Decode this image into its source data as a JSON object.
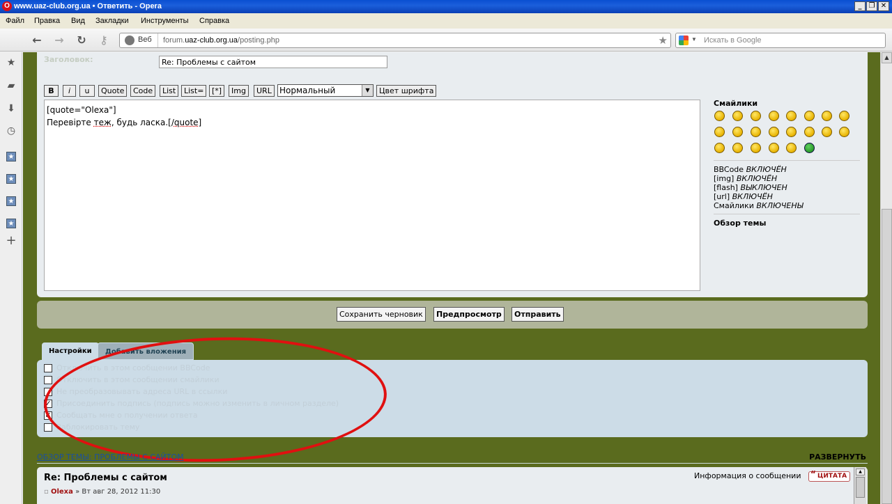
{
  "window": {
    "title": "www.uaz-club.org.ua • Ответить - Opera",
    "minimize": "_",
    "restore": "❐",
    "close": "✕"
  },
  "menu": [
    "Файл",
    "Правка",
    "Вид",
    "Закладки",
    "Инструменты",
    "Справка"
  ],
  "nav": {
    "veb_label": "Веб",
    "url_prefix": "forum.",
    "url_host": "uaz-club.org.ua",
    "url_path": "/posting.php",
    "search_placeholder": "Искать в Google"
  },
  "form": {
    "subject_label": "Заголовок:",
    "subject_value": "Re: Проблемы с сайтом",
    "bbcode_buttons": [
      "B",
      "i",
      "u",
      "Quote",
      "Code",
      "List",
      "List=",
      "[*]",
      "Img",
      "URL"
    ],
    "font_size_value": "Нормальный",
    "font_color_button": "Цвет шрифта",
    "text_line1": "[quote=\"Olexa\"]",
    "text_line2_a": "Перевірте ",
    "text_line2_b": "теж",
    "text_line2_c": ", будь ласка.[/",
    "text_line2_d": "quote",
    "text_line2_e": "]"
  },
  "sidebar": {
    "smileys_title": "Смайлики",
    "options": [
      {
        "name": "BBCode",
        "state": "ВКЛЮЧЁН"
      },
      {
        "name": "[img]",
        "state": "ВКЛЮЧЁН"
      },
      {
        "name": "[flash]",
        "state": "ВЫКЛЮЧЕН"
      },
      {
        "name": "[url]",
        "state": "ВКЛЮЧЁН"
      },
      {
        "name": "Смайлики",
        "state": "ВКЛЮЧЕНЫ"
      }
    ],
    "topic_review": "Обзор темы"
  },
  "submit": {
    "save_draft": "Сохранить черновик",
    "preview": "Предпросмотр",
    "send": "Отправить"
  },
  "tabs": {
    "settings": "Настройки",
    "attachments": "Добавить вложения"
  },
  "checkboxes": [
    {
      "checked": false,
      "label": "Отключить в этом сообщении BBCode"
    },
    {
      "checked": false,
      "label": "Отключить в этом сообщении смайлики"
    },
    {
      "checked": false,
      "label": "Не преобразовывать адреса URL в ссылки"
    },
    {
      "checked": true,
      "label": "Присоединить подпись (подпись можно изменить в личном разделе)"
    },
    {
      "checked": true,
      "label": "Сообщать мне о получении ответа"
    },
    {
      "checked": false,
      "label": "Заблокировать тему"
    }
  ],
  "review": {
    "title": "ОБЗОР ТЕМЫ: ПРОБЛЕМЫ С САЙТОМ",
    "expand": "РАЗВЕРНУТЬ",
    "post_title": "Re: Проблемы с сайтом",
    "post_author": "Olexa",
    "post_date": "» Вт авг 28, 2012 11:30",
    "msg_info": "Информация о сообщении",
    "cite": "ЦИТАТА"
  }
}
